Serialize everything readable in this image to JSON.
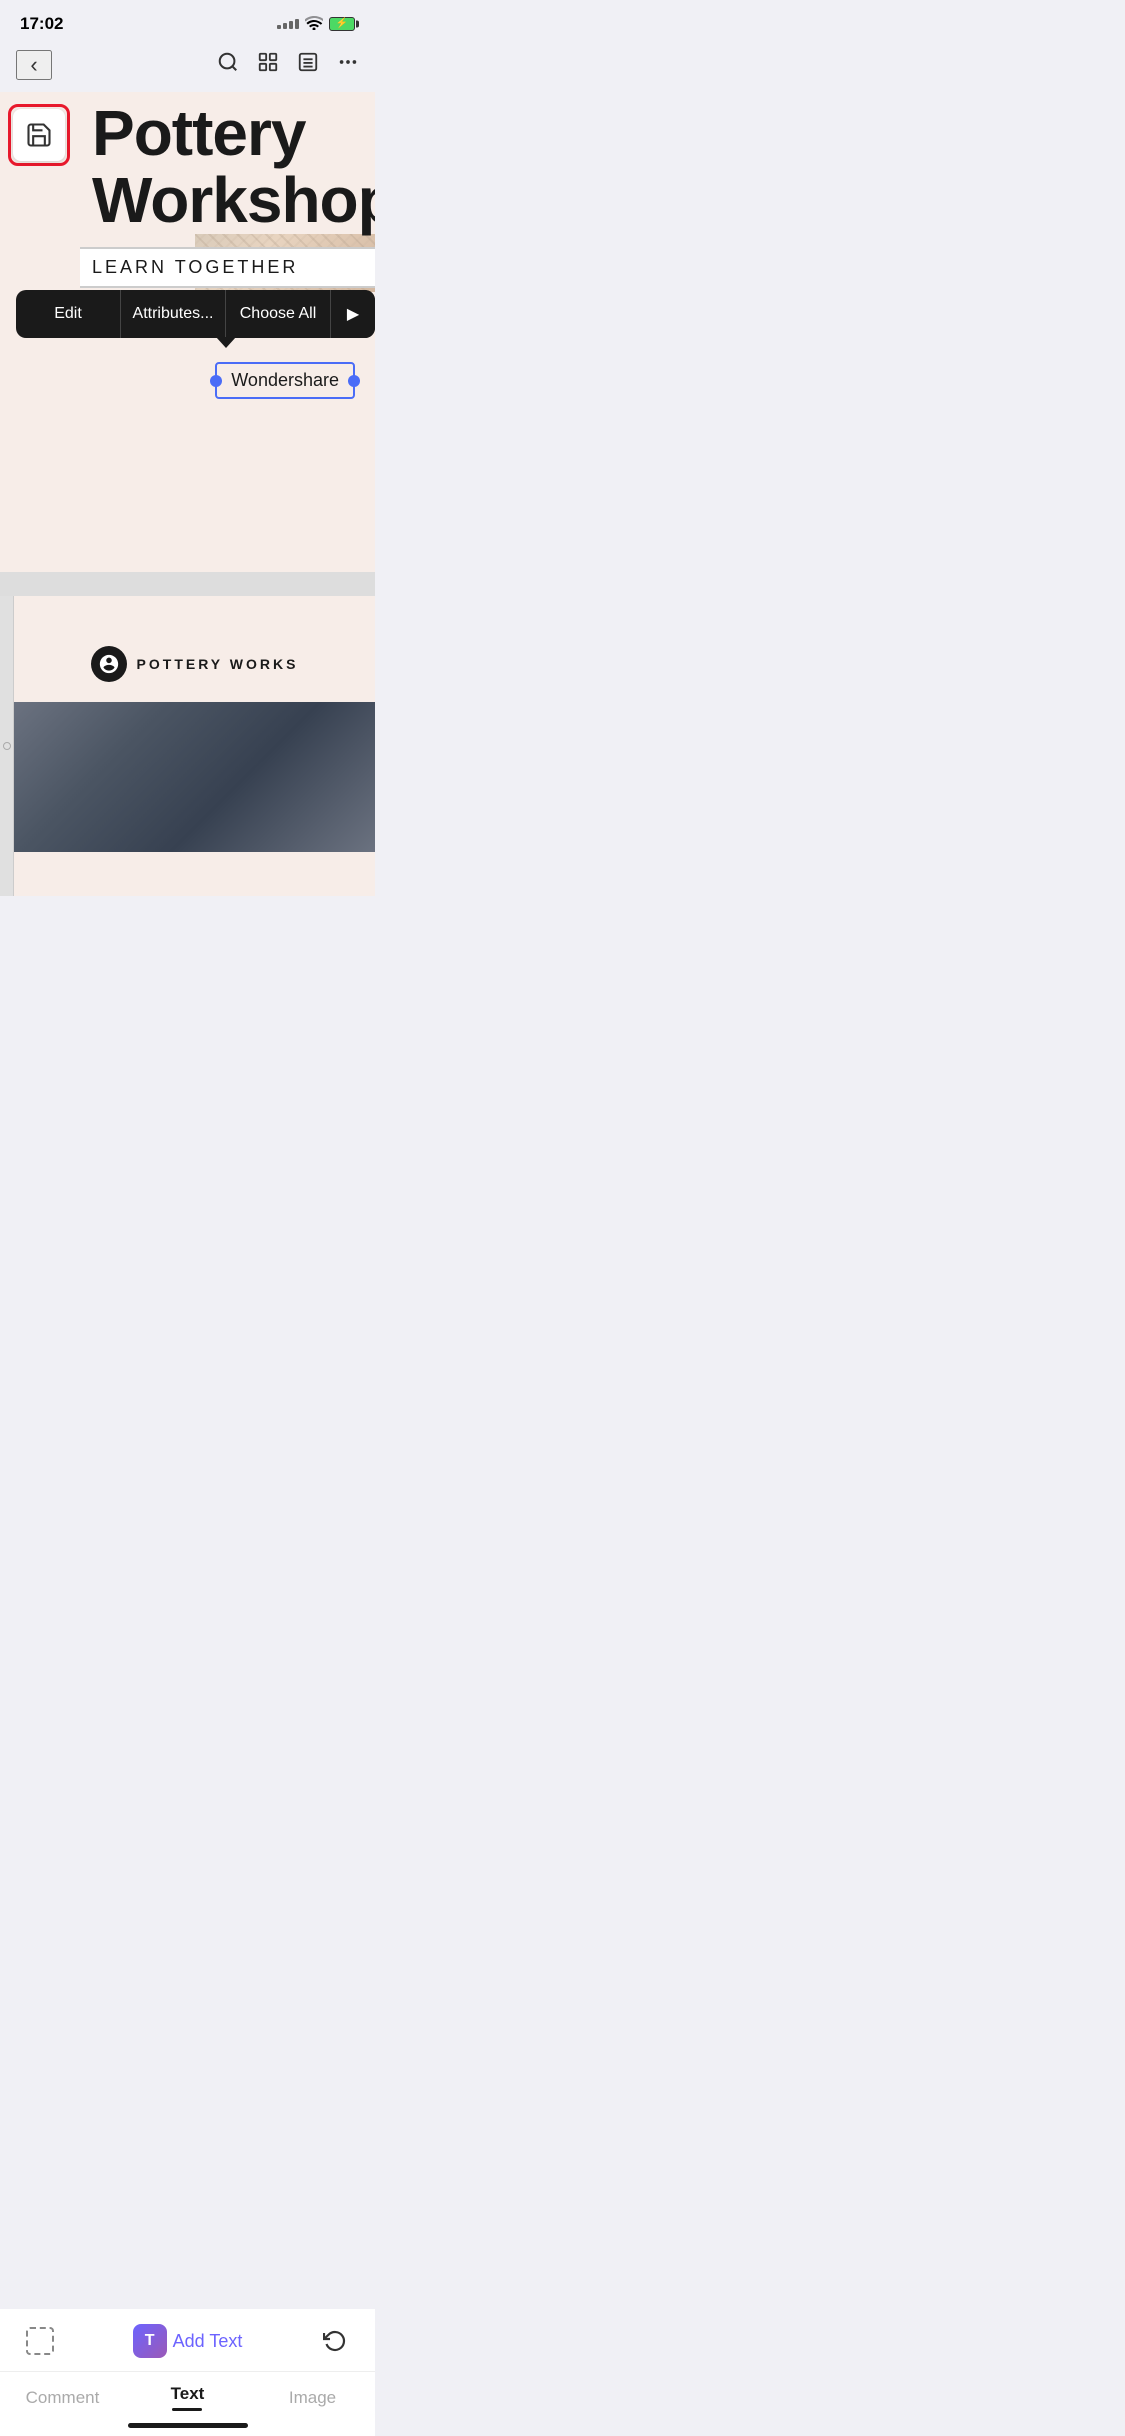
{
  "statusBar": {
    "time": "17:02"
  },
  "topNav": {
    "backLabel": "‹",
    "searchIcon": "search",
    "gridIcon": "grid",
    "listIcon": "list",
    "moreIcon": "more"
  },
  "canvas": {
    "workshopTitle": "Pottery\nWorkshop",
    "learnTogetherlabel": "LEARN TOGETHER",
    "saveButtonLabel": "save",
    "contextMenu": {
      "editLabel": "Edit",
      "attributesLabel": "Attributes...",
      "chooseAllLabel": "Choose All",
      "arrowLabel": "▶"
    },
    "wondershareText": "Wondershare"
  },
  "canvas2": {
    "brandName": "POTTERY WORKS"
  },
  "bottomBar": {
    "addTextLabel": "Add Text",
    "addTextIcon": "T",
    "tabs": [
      {
        "label": "Comment",
        "active": false
      },
      {
        "label": "Text",
        "active": true
      },
      {
        "label": "Image",
        "active": false
      }
    ]
  }
}
